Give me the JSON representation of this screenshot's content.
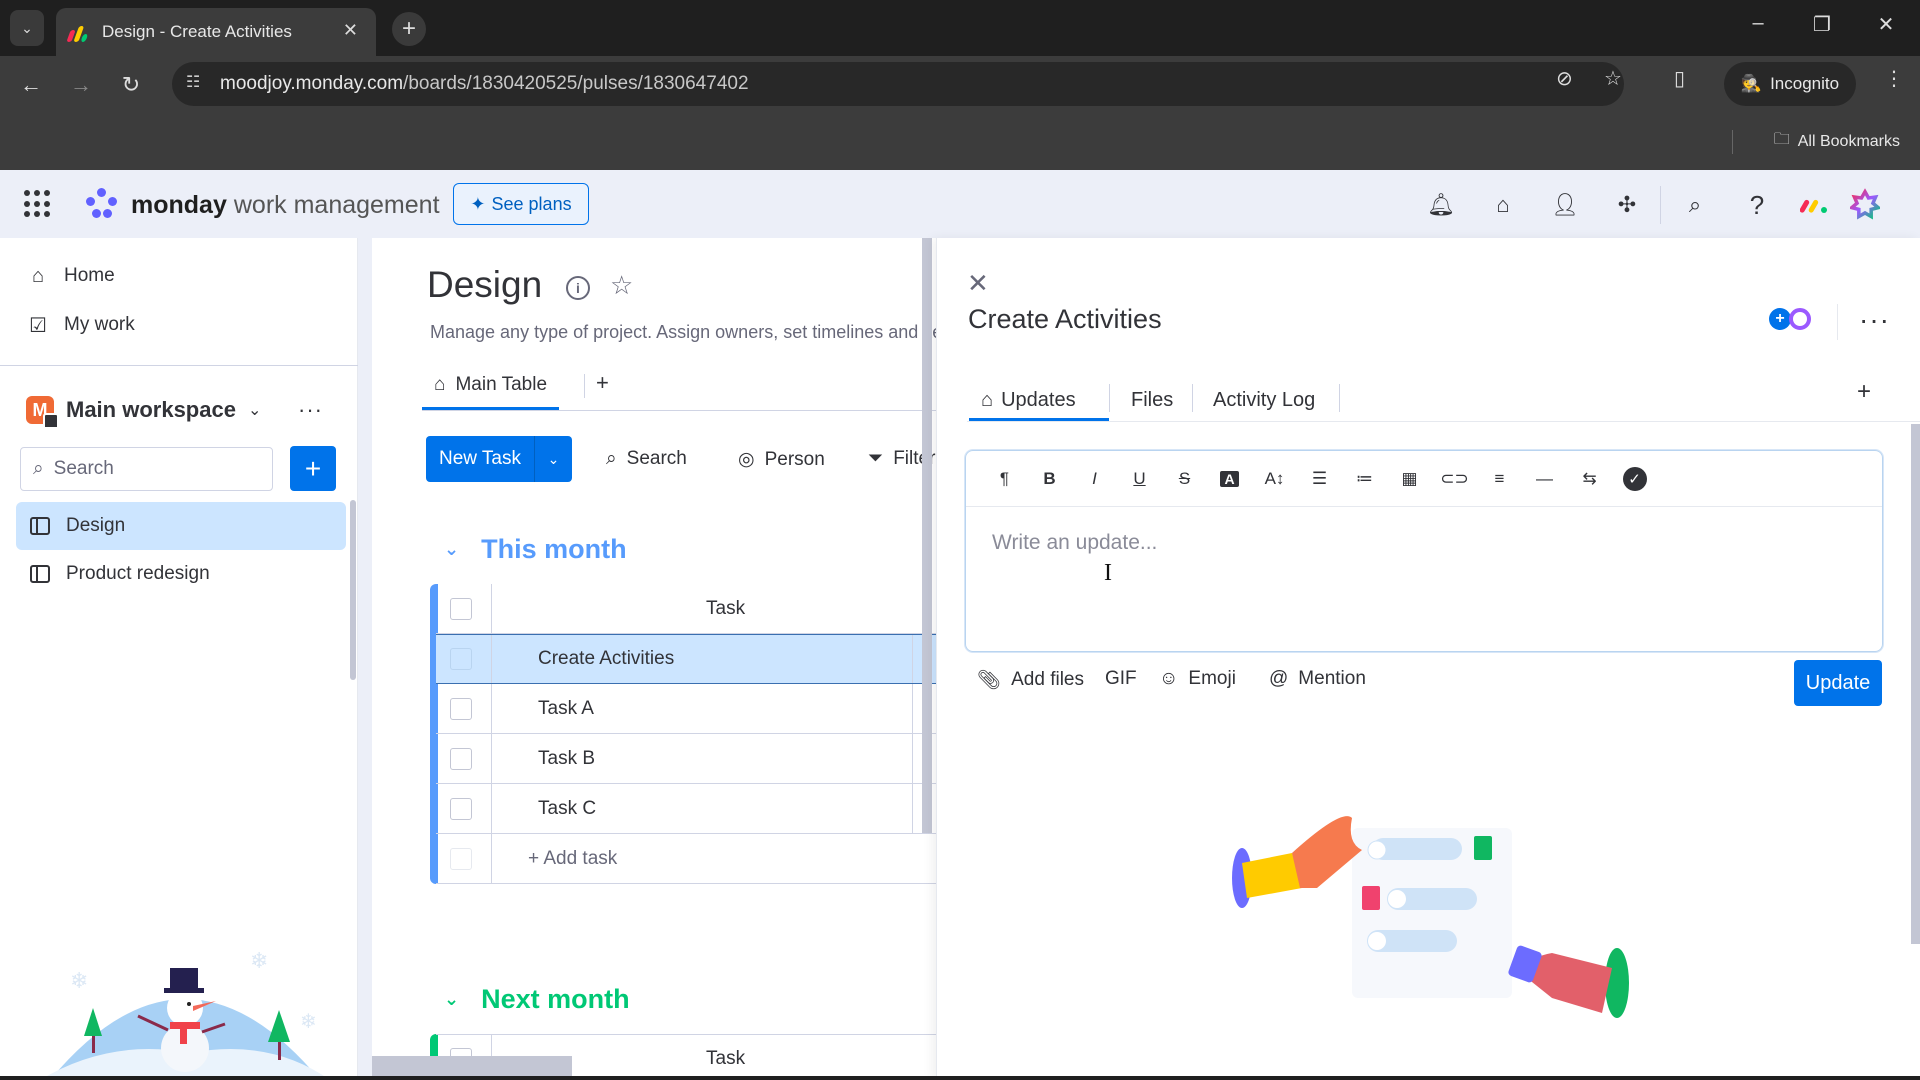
{
  "browser": {
    "tab_title": "Design - Create Activities",
    "url_host": "moodjoy.monday.com",
    "url_path": "/boards/1830420525/pulses/1830647402",
    "incognito_label": "Incognito",
    "all_bookmarks_label": "All Bookmarks"
  },
  "header": {
    "brand_bold": "monday",
    "brand_rest": "work management",
    "see_plans_label": "See plans",
    "icons": [
      "bell-icon",
      "inbox-icon",
      "invite-icon",
      "apps-icon",
      "search-icon",
      "help-icon",
      "monday-logo-icon",
      "avatar-icon"
    ]
  },
  "sidebar": {
    "nav": [
      {
        "label": "Home",
        "icon": "home-icon"
      },
      {
        "label": "My work",
        "icon": "calendar-check-icon"
      }
    ],
    "workspace": {
      "initial": "M",
      "name": "Main workspace"
    },
    "search_placeholder": "Search",
    "boards": [
      {
        "label": "Design",
        "active": true
      },
      {
        "label": "Product redesign",
        "active": false
      }
    ]
  },
  "board": {
    "title": "Design",
    "description": "Manage any type of project. Assign owners, set timelines and keep track of where your project stands.",
    "view_tab": "Main Table",
    "new_task_label": "New Task",
    "toolbar": [
      {
        "label": "Search",
        "icon": "search-icon"
      },
      {
        "label": "Person",
        "icon": "person-icon"
      },
      {
        "label": "Filter",
        "icon": "filter-icon"
      }
    ],
    "groups": [
      {
        "title": "This month",
        "color": "#579bfc",
        "column_header": "Task",
        "rows": [
          "Create Activities",
          "Task A",
          "Task B",
          "Task C"
        ],
        "selected_row": "Create Activities",
        "add_label": "+ Add task"
      },
      {
        "title": "Next month",
        "color": "#00c875",
        "column_header": "Task"
      }
    ]
  },
  "panel": {
    "title": "Create Activities",
    "tabs": [
      {
        "label": "Updates",
        "active": true
      },
      {
        "label": "Files",
        "active": false
      },
      {
        "label": "Activity Log",
        "active": false
      }
    ],
    "editor_placeholder": "Write an update...",
    "format_tools": [
      "¶",
      "B",
      "I",
      "U",
      "S",
      "A",
      "A↕",
      "numbered-list",
      "bullet-list",
      "table",
      "link",
      "align",
      "divider",
      "direction",
      "checklist"
    ],
    "actions": [
      {
        "label": "Add files",
        "icon": "paperclip-icon"
      },
      {
        "label": "GIF",
        "icon": ""
      },
      {
        "label": "Emoji",
        "icon": "smiley-icon"
      },
      {
        "label": "Mention",
        "icon": "at-icon"
      }
    ],
    "update_button": "Update"
  }
}
